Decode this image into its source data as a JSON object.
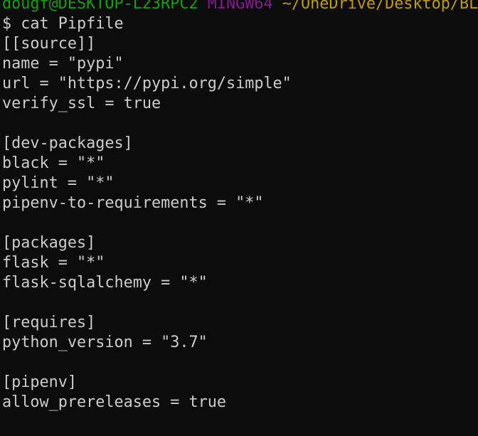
{
  "prompt": {
    "user_host": "dougf@DESKTOP-L23RPC2",
    "env": "MINGW64",
    "path": "~/OneDrive/Desktop/BL_"
  },
  "command": "$ cat Pipfile",
  "output_lines": [
    "[[source]]",
    "name = \"pypi\"",
    "url = \"https://pypi.org/simple\"",
    "verify_ssl = true",
    "",
    "[dev-packages]",
    "black = \"*\"",
    "pylint = \"*\"",
    "pipenv-to-requirements = \"*\"",
    "",
    "[packages]",
    "flask = \"*\"",
    "flask-sqlalchemy = \"*\"",
    "",
    "[requires]",
    "python_version = \"3.7\"",
    "",
    "[pipenv]",
    "allow_prereleases = true"
  ],
  "colors": {
    "background": "#0c0c0c",
    "foreground": "#cccccc",
    "user_host": "#13a10e",
    "env": "#881798",
    "path": "#c19c00"
  }
}
